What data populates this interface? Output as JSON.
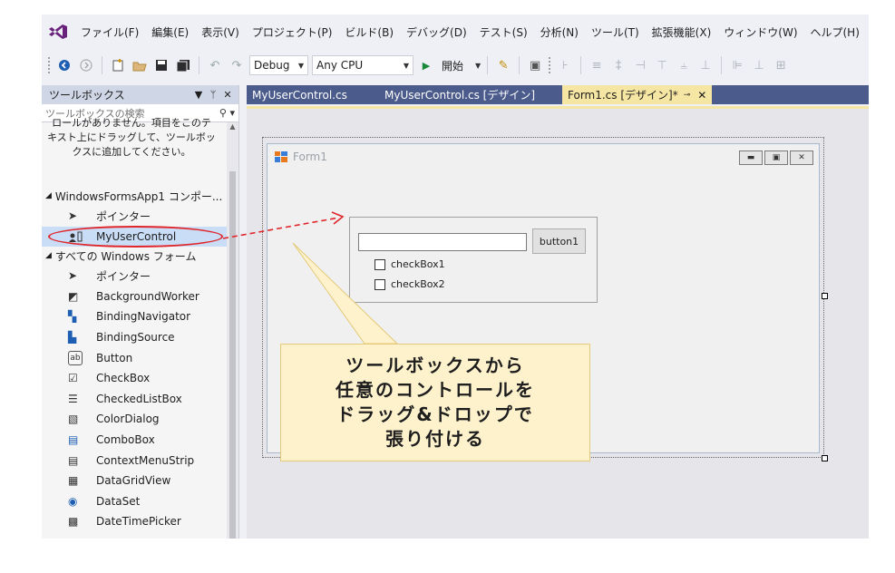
{
  "menu": [
    "ファイル(F)",
    "編集(E)",
    "表示(V)",
    "プロジェクト(P)",
    "ビルド(B)",
    "デバッグ(D)",
    "テスト(S)",
    "分析(N)",
    "ツール(T)",
    "拡張機能(X)",
    "ウィンドウ(W)",
    "ヘルプ(H)"
  ],
  "toolbar": {
    "config": "Debug",
    "platform": "Any CPU",
    "start_label": "開始"
  },
  "toolbox": {
    "title": "ツールボックス",
    "search_placeholder": "ツールボックスの検索",
    "hint_lines": [
      "ロールがありません。項目をこのテ",
      "キスト上にドラッグして、ツールボッ",
      "クスに追加してください。"
    ],
    "group1": "WindowsFormsApp1 コンポー...",
    "group1_items": [
      "ポインター",
      "MyUserControl"
    ],
    "group2": "すべての Windows フォーム",
    "group2_items": [
      "ポインター",
      "BackgroundWorker",
      "BindingNavigator",
      "BindingSource",
      "Button",
      "CheckBox",
      "CheckedListBox",
      "ColorDialog",
      "ComboBox",
      "ContextMenuStrip",
      "DataGridView",
      "DataSet",
      "DateTimePicker"
    ]
  },
  "tabs": [
    "MyUserControl.cs",
    "MyUserControl.cs [デザイン]",
    "Form1.cs [デザイン]*"
  ],
  "form": {
    "title": "Form1",
    "button_label": "button1",
    "checkbox1": "checkBox1",
    "checkbox2": "checkBox2",
    "textbox_value": ""
  },
  "callout": [
    "ツールボックスから",
    "任意のコントロールを",
    "ドラッグ&ドロップで",
    "張り付ける"
  ],
  "colors": {
    "accent": "#4b5b8c",
    "active_tab": "#f6e6a3",
    "highlight": "#e0262b",
    "callout_fill": "#fef2cc"
  }
}
